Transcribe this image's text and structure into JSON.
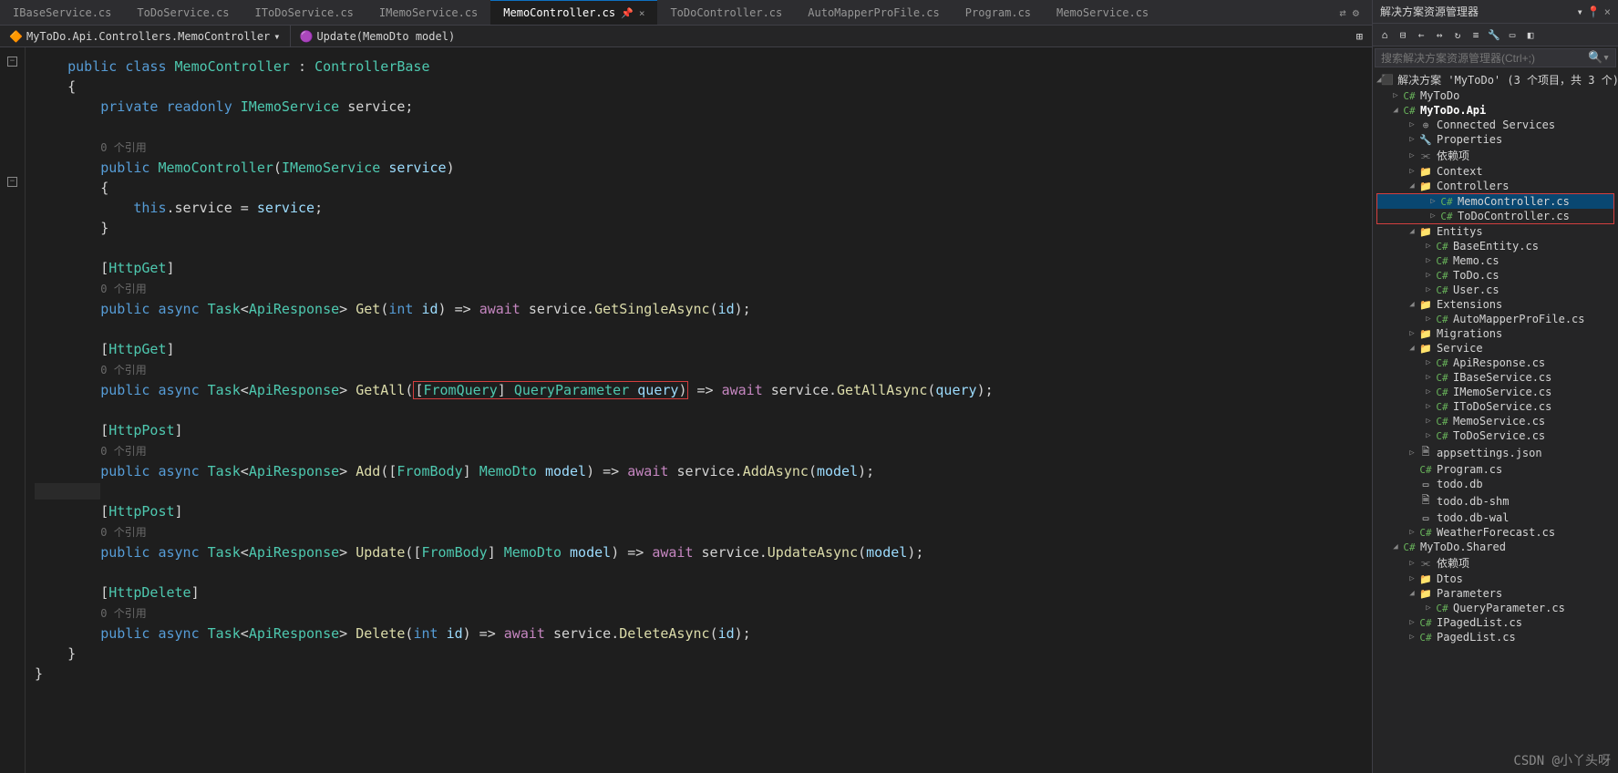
{
  "tabs": {
    "items": [
      {
        "label": "IBaseService.cs"
      },
      {
        "label": "ToDoService.cs"
      },
      {
        "label": "IToDoService.cs"
      },
      {
        "label": "IMemoService.cs"
      },
      {
        "label": "MemoController.cs",
        "active": true
      },
      {
        "label": "ToDoController.cs"
      },
      {
        "label": "AutoMapperProFile.cs"
      },
      {
        "label": "Program.cs"
      },
      {
        "label": "MemoService.cs"
      }
    ]
  },
  "nav": {
    "left": "MyToDo.Api.Controllers.MemoController",
    "right": "Update(MemoDto model)"
  },
  "refs": "0 个引用",
  "code": {
    "kw_public": "public",
    "kw_class": "class",
    "kw_private": "private",
    "kw_readonly": "readonly",
    "kw_this": "this",
    "kw_async": "async",
    "kw_await": "await",
    "kw_int": "int",
    "ty_MemoController": "MemoController",
    "ty_ControllerBase": "ControllerBase",
    "ty_IMemoService": "IMemoService",
    "ty_Task": "Task",
    "ty_ApiResponse": "ApiResponse",
    "ty_QueryParameter": "QueryParameter",
    "ty_MemoDto": "MemoDto",
    "attr_HttpGet": "HttpGet",
    "attr_HttpPost": "HttpPost",
    "attr_HttpDelete": "HttpDelete",
    "attr_FromQuery": "FromQuery",
    "attr_FromBody": "FromBody",
    "fn_Get": "Get",
    "fn_GetAll": "GetAll",
    "fn_Add": "Add",
    "fn_Update": "Update",
    "fn_Delete": "Delete",
    "m_GetSingleAsync": "GetSingleAsync",
    "m_GetAllAsync": "GetAllAsync",
    "m_AddAsync": "AddAsync",
    "m_UpdateAsync": "UpdateAsync",
    "m_DeleteAsync": "DeleteAsync",
    "id_service": "service",
    "id_id": "id",
    "id_query": "query",
    "id_model": "model"
  },
  "solution": {
    "title": "解决方案资源管理器",
    "search_placeholder": "搜索解决方案资源管理器(Ctrl+;)",
    "root": "解决方案 'MyToDo' (3 个项目，共 3 个)",
    "proj1": "MyToDo",
    "proj2": "MyToDo.Api",
    "proj3": "MyToDo.Shared",
    "connected": "Connected Services",
    "properties": "Properties",
    "deps": "依赖项",
    "context": "Context",
    "controllers": "Controllers",
    "memoctrl": "MemoController.cs",
    "todoctrl": "ToDoController.cs",
    "entitys": "Entitys",
    "baseentity": "BaseEntity.cs",
    "memo": "Memo.cs",
    "todo": "ToDo.cs",
    "user": "User.cs",
    "extensions": "Extensions",
    "automapper": "AutoMapperProFile.cs",
    "migrations": "Migrations",
    "service": "Service",
    "apiresponse": "ApiResponse.cs",
    "ibaseservice": "IBaseService.cs",
    "imemoservice": "IMemoService.cs",
    "itodoservice": "IToDoService.cs",
    "memoservice": "MemoService.cs",
    "todoservice": "ToDoService.cs",
    "appsettings": "appsettings.json",
    "programcs": "Program.cs",
    "tododb": "todo.db",
    "todoshm": "todo.db-shm",
    "todowal": "todo.db-wal",
    "weather": "WeatherForecast.cs",
    "dtos": "Dtos",
    "parameters": "Parameters",
    "queryparam": "QueryParameter.cs",
    "ipagedlist": "IPagedList.cs",
    "pagedlist": "PagedList.cs"
  },
  "watermark": "CSDN @小丫头呀"
}
